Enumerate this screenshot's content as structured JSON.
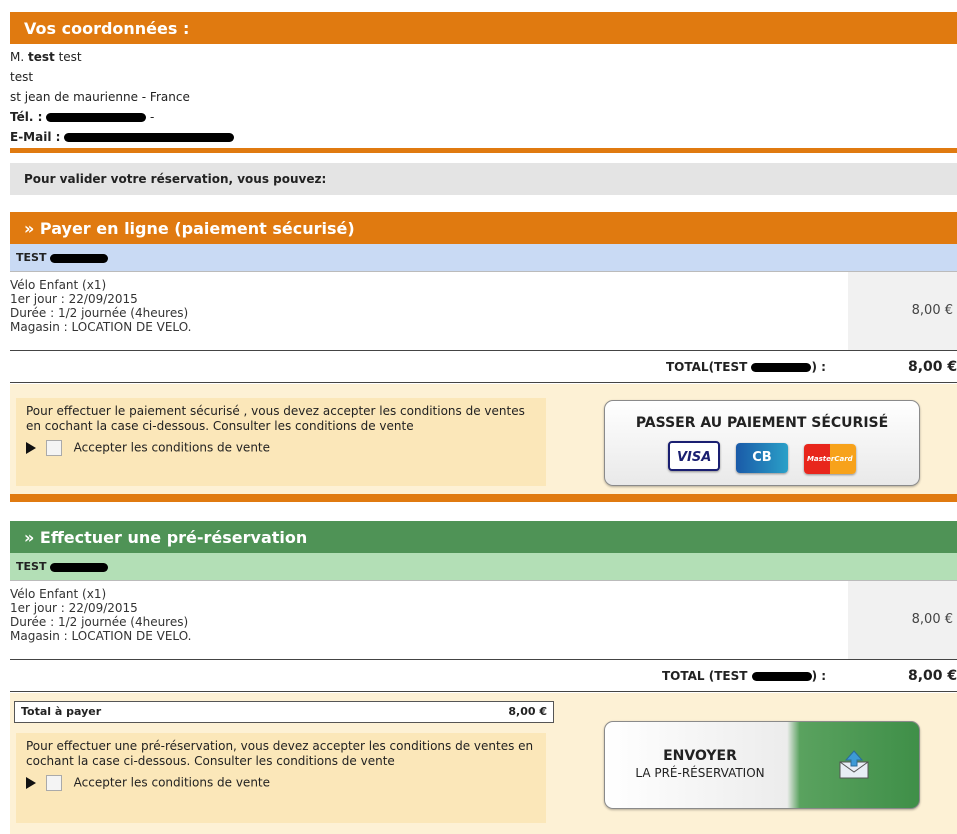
{
  "contact": {
    "header": "Vos coordonnées :",
    "salutation_prefix": "M.",
    "name_bold": "test",
    "name_rest": "test",
    "line2": "test",
    "city": "st jean de maurienne - France",
    "tel_label": "Tél. :",
    "tel_suffix": "-",
    "email_label": "E-Mail :"
  },
  "validate_text": "Pour valider votre réservation, vous pouvez:",
  "online": {
    "header": "» Payer en ligne (paiement sécurisé)",
    "client_label": "TEST",
    "item": {
      "line1": "Vélo Enfant (x1)",
      "line2": "1er jour : 22/09/2015",
      "line3": "Durée : 1/2 journée (4heures)",
      "line4": "Magasin : LOCATION DE VELO."
    },
    "item_price": "8,00 €",
    "total_label": "TOTAL(TEST",
    "total_colon": ") :",
    "total_value": "8,00 €",
    "notice": "Pour effectuer le paiement sécurisé , vous devez accepter les conditions de ventes en cochant la case ci-dessous. Consulter les conditions de vente",
    "accept_label": "Accepter les conditions de vente",
    "button_label": "PASSER AU PAIEMENT SÉCURISÉ",
    "cards": [
      "VISA",
      "CB",
      "MasterCard"
    ]
  },
  "prereserve": {
    "header": "» Effectuer une pré-réservation",
    "client_label": "TEST",
    "item": {
      "line1": "Vélo Enfant (x1)",
      "line2": "1er jour : 22/09/2015",
      "line3": "Durée : 1/2 journée (4heures)",
      "line4": "Magasin : LOCATION DE VELO."
    },
    "item_price": "8,00 €",
    "total_label": "TOTAL (TEST",
    "total_colon": ") :",
    "total_value": "8,00 €",
    "pay_label": "Total à payer",
    "pay_value": "8,00 €",
    "notice": "Pour effectuer une pré-réservation, vous devez accepter les conditions de ventes en cochant la case ci-dessous. Consulter les conditions de vente",
    "accept_label": "Accepter les conditions de vente",
    "button_title": "ENVOYER",
    "button_sub": "LA PRÉ-RÉSERVATION"
  },
  "colors": {
    "orange": "#e07a10",
    "green": "#4f9356",
    "blue_row": "#c9daf4",
    "green_row": "#b3dfb6",
    "cream": "#fdf1d5"
  }
}
